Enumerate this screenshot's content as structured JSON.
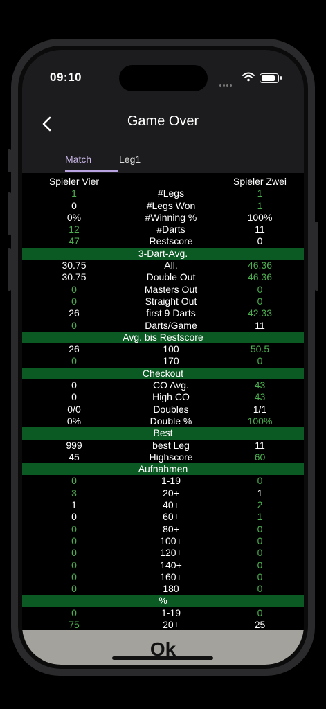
{
  "status": {
    "time": "09:10"
  },
  "nav": {
    "title": "Game Over"
  },
  "tabs": [
    {
      "label": "Match"
    },
    {
      "label": "Leg1"
    }
  ],
  "players": {
    "left": "Spieler Vier",
    "right": "Spieler Zwei"
  },
  "rows": [
    {
      "type": "row",
      "left": "1",
      "label": "#Legs",
      "right": "1",
      "lg": true,
      "rg": true
    },
    {
      "type": "row",
      "left": "0",
      "label": "#Legs Won",
      "right": "1",
      "lg": false,
      "rg": true
    },
    {
      "type": "row",
      "left": "0%",
      "label": "#Winning %",
      "right": "100%",
      "lg": false,
      "rg": false
    },
    {
      "type": "row",
      "left": "12",
      "label": "#Darts",
      "right": "11",
      "lg": true,
      "rg": false
    },
    {
      "type": "row",
      "left": "47",
      "label": "Restscore",
      "right": "0",
      "lg": true,
      "rg": false
    },
    {
      "type": "section",
      "label": "3-Dart-Avg."
    },
    {
      "type": "row",
      "left": "30.75",
      "label": "All.",
      "right": "46.36",
      "lg": false,
      "rg": true
    },
    {
      "type": "row",
      "left": "30.75",
      "label": "Double Out",
      "right": "46.36",
      "lg": false,
      "rg": true
    },
    {
      "type": "row",
      "left": "0",
      "label": "Masters Out",
      "right": "0",
      "lg": true,
      "rg": true
    },
    {
      "type": "row",
      "left": "0",
      "label": "Straight Out",
      "right": "0",
      "lg": true,
      "rg": true
    },
    {
      "type": "row",
      "left": "26",
      "label": "first 9 Darts",
      "right": "42.33",
      "lg": false,
      "rg": true
    },
    {
      "type": "row",
      "left": "0",
      "label": "Darts/Game",
      "right": "11",
      "lg": true,
      "rg": false
    },
    {
      "type": "section",
      "label": "Avg. bis Restscore"
    },
    {
      "type": "row",
      "left": "26",
      "label": "100",
      "right": "50.5",
      "lg": false,
      "rg": true
    },
    {
      "type": "row",
      "left": "0",
      "label": "170",
      "right": "0",
      "lg": true,
      "rg": true
    },
    {
      "type": "section",
      "label": "Checkout"
    },
    {
      "type": "row",
      "left": "0",
      "label": "CO Avg.",
      "right": "43",
      "lg": false,
      "rg": true
    },
    {
      "type": "row",
      "left": "0",
      "label": "High CO",
      "right": "43",
      "lg": false,
      "rg": true
    },
    {
      "type": "row",
      "left": "0/0",
      "label": "Doubles",
      "right": "1/1",
      "lg": false,
      "rg": false
    },
    {
      "type": "row",
      "left": "0%",
      "label": "Double %",
      "right": "100%",
      "lg": false,
      "rg": true
    },
    {
      "type": "section",
      "label": "Best"
    },
    {
      "type": "row",
      "left": "999",
      "label": "best Leg",
      "right": "11",
      "lg": false,
      "rg": false
    },
    {
      "type": "row",
      "left": "45",
      "label": "Highscore",
      "right": "60",
      "lg": false,
      "rg": true
    },
    {
      "type": "section",
      "label": "Aufnahmen"
    },
    {
      "type": "row",
      "left": "0",
      "label": "1-19",
      "right": "0",
      "lg": true,
      "rg": true
    },
    {
      "type": "row",
      "left": "3",
      "label": "20+",
      "right": "1",
      "lg": true,
      "rg": false
    },
    {
      "type": "row",
      "left": "1",
      "label": "40+",
      "right": "2",
      "lg": false,
      "rg": true
    },
    {
      "type": "row",
      "left": "0",
      "label": "60+",
      "right": "1",
      "lg": false,
      "rg": true
    },
    {
      "type": "row",
      "left": "0",
      "label": "80+",
      "right": "0",
      "lg": true,
      "rg": true
    },
    {
      "type": "row",
      "left": "0",
      "label": "100+",
      "right": "0",
      "lg": true,
      "rg": true
    },
    {
      "type": "row",
      "left": "0",
      "label": "120+",
      "right": "0",
      "lg": true,
      "rg": true
    },
    {
      "type": "row",
      "left": "0",
      "label": "140+",
      "right": "0",
      "lg": true,
      "rg": true
    },
    {
      "type": "row",
      "left": "0",
      "label": "160+",
      "right": "0",
      "lg": true,
      "rg": true
    },
    {
      "type": "row",
      "left": "0",
      "label": "180",
      "right": "0",
      "lg": true,
      "rg": true
    },
    {
      "type": "section",
      "label": "%"
    },
    {
      "type": "row",
      "left": "0",
      "label": "1-19",
      "right": "0",
      "lg": true,
      "rg": true
    },
    {
      "type": "row",
      "left": "75",
      "label": "20+",
      "right": "25",
      "lg": true,
      "rg": false
    }
  ],
  "ok_label": "Ok",
  "colors": {
    "accent_green": "#4caf50",
    "section_bg": "#0c5a23",
    "tab_active": "#c8b6e6",
    "ok_bar": "#a3a29c"
  }
}
